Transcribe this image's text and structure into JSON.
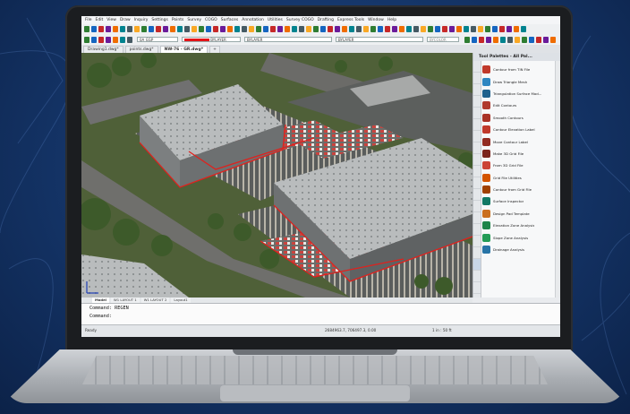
{
  "app": {
    "menus": [
      "File",
      "Edit",
      "View",
      "Draw",
      "Inquiry",
      "Settings",
      "Points",
      "Survey",
      "COGO",
      "Surfaces",
      "Annotation",
      "Utilities",
      "Survey COGO",
      "Drafting",
      "Express Tools",
      "Window",
      "Help"
    ],
    "layer_combo": "0A_EGP",
    "color_combo": "BYLAYER",
    "linetype_combo": "BYLAYER",
    "lineweight_combo": "BYLAYER",
    "plotstyle_combo": "BYCOLOR",
    "document_tabs": [
      "Drawing1.dwg*",
      "points.dwg*",
      "NW-76 - GR.dwg*"
    ],
    "active_tab_index": 2
  },
  "palette": {
    "title": "Tool Palettes - All Pal...",
    "items": [
      {
        "label": "Contour from TIN File",
        "color": "#c0392b"
      },
      {
        "label": "Draw Triangle Mesh",
        "color": "#2e86c1"
      },
      {
        "label": "Triangulation Surface Mod...",
        "color": "#1f618d"
      },
      {
        "label": "Edit Contours",
        "color": "#b03a2e"
      },
      {
        "label": "Smooth Contours",
        "color": "#a93226"
      },
      {
        "label": "Contour Elevation Label",
        "color": "#c0392b"
      },
      {
        "label": "Move Contour Label",
        "color": "#922b21"
      },
      {
        "label": "Make 3D Grid File",
        "color": "#7b241c"
      },
      {
        "label": "From 3D Grid File",
        "color": "#cb4335"
      },
      {
        "label": "Grid File Utilities",
        "color": "#d35400"
      },
      {
        "label": "Contour from Grid File",
        "color": "#a04000"
      },
      {
        "label": "Surface Inspector",
        "color": "#117864"
      },
      {
        "label": "Design Pad Template",
        "color": "#ca6f1e"
      },
      {
        "label": "Elevation Zone Analysis",
        "color": "#1e8449"
      },
      {
        "label": "Slope Zone Analysis",
        "color": "#239b56"
      },
      {
        "label": "Drainage Analysis",
        "color": "#2874a6"
      }
    ]
  },
  "layout_tabs": [
    "Model",
    "W1 LAYOUT 1",
    "W1 LAYOUT 2",
    "Layout1"
  ],
  "command": {
    "line1": "Command: REGEN",
    "line2": "Command:"
  },
  "status": {
    "left": "Ready",
    "coords": "2684963.7, 706497.3, 0.00",
    "scale": "1 in : 50 ft"
  }
}
